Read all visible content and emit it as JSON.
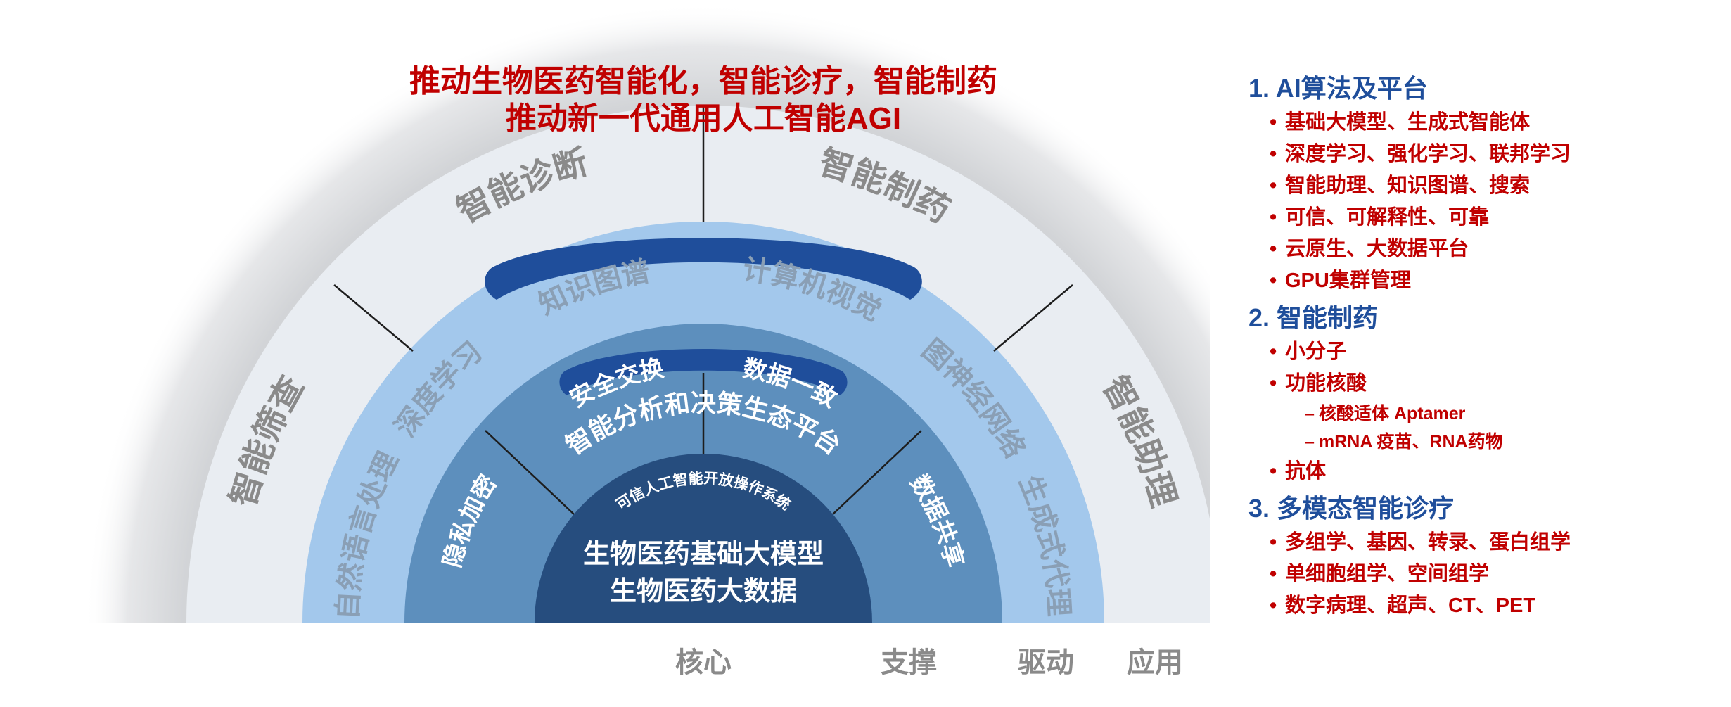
{
  "headline": {
    "line1": "推动生物医药智能化，智能诊疗，智能制药",
    "line2": "推动新一代通用人工智能AGI"
  },
  "outer_ring": [
    "智能筛查",
    "智能诊断",
    "智能制药",
    "智能助理"
  ],
  "platform_banner": "智能分析和决策生态平台",
  "ring3_labels": [
    "自然语言处理",
    "深度学习",
    "知识图谱",
    "计算机视觉",
    "图神经网络",
    "生成式代理"
  ],
  "os_banner": "可信人工智能开放操作系统",
  "ring2_labels": [
    "隐私加密",
    "安全交换",
    "数据一致",
    "数据共享"
  ],
  "core": {
    "line1": "生物医药基础大模型",
    "line2": "生物医药大数据"
  },
  "bottom_labels": [
    "核心",
    "支撑",
    "驱动",
    "应用"
  ],
  "sidebar": {
    "sections": [
      {
        "title": "1. AI算法及平台",
        "items": [
          {
            "text": "基础大模型、生成式智能体"
          },
          {
            "text": "深度学习、强化学习、联邦学习"
          },
          {
            "text": "智能助理、知识图谱、搜索"
          },
          {
            "text": "可信、可解释性、可靠"
          },
          {
            "text": "云原生、大数据平台"
          },
          {
            "text": "GPU集群管理"
          }
        ]
      },
      {
        "title": "2. 智能制药",
        "items": [
          {
            "text": "小分子"
          },
          {
            "text": "功能核酸"
          },
          {
            "text": "核酸适体 Aptamer",
            "sub": true
          },
          {
            "text": "mRNA 疫苗、RNA药物",
            "sub": true
          },
          {
            "text": "抗体"
          }
        ]
      },
      {
        "title": "3. 多模态智能诊疗",
        "items": [
          {
            "text": "多组学、基因、转录、蛋白组学"
          },
          {
            "text": "单细胞组学、空间组学"
          },
          {
            "text": "数字病理、超声、CT、PET"
          }
        ]
      }
    ]
  },
  "colors": {
    "headline": "#c00000",
    "outer_ring": "#e9edf2",
    "ring3": "#a3c8ec",
    "ring2": "#5d8fbd",
    "core": "#264d7e",
    "banner": "#1f4e9b",
    "label_gray": "#8a8a8a",
    "sidebar_title": "#1f4e9b",
    "sidebar_item": "#c00000"
  }
}
